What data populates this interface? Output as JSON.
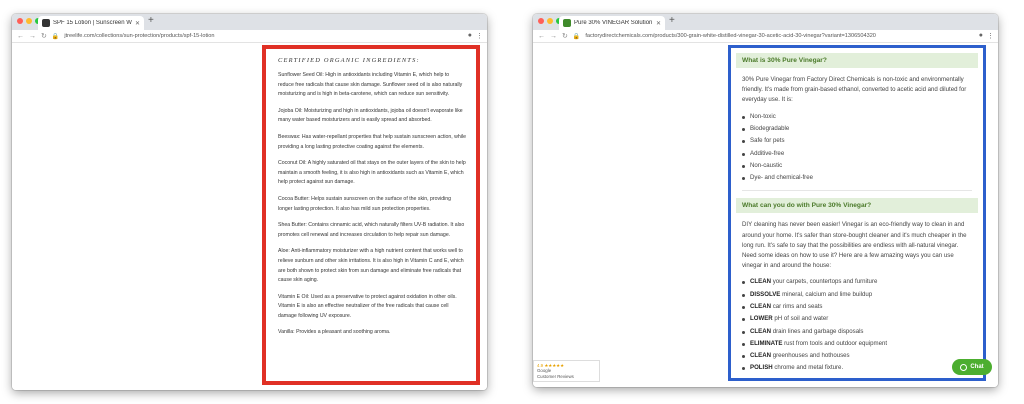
{
  "colors": {
    "red_box": "#e03025",
    "blue_box": "#2d5fcc",
    "header_bg": "#e2efda",
    "header_text": "#4b7a2a",
    "chat_green": "#4cae2f"
  },
  "left_browser": {
    "tab_title": "SPF 15 Lotion | Sunscreen Wit",
    "url": "jtreelife.com/collections/sun-protection/products/spf-15-lotion",
    "heading": "CERTIFIED ORGANIC INGREDIENTS:",
    "paragraphs": [
      "Sunflower Seed Oil: High in antioxidants including Vitamin E, which help to reduce free radicals that cause skin damage. Sunflower seed oil is also naturally moisturizing and is high in beta-carotene, which can reduce sun sensitivity.",
      "Jojoba Oil: Moisturizing and high in antioxidants, jojoba oil doesn't evaporate like many water based moisturizers and is easily spread and absorbed.",
      "Beeswax: Has water-repellant properties that help sustain sunscreen action, while providing a long lasting protective coating against the elements.",
      "Coconut Oil: A highly saturated oil that stays on the outer layers of the skin to help maintain a smooth feeling, it is also high in antioxidants such as Vitamin E, which help protect against sun damage.",
      "Cocoa Butter: Helps sustain sunscreen on the surface of the skin, providing longer lasting protection. It also has mild sun protection properties.",
      "Shea Butter: Contains cinnamic acid, which naturally filters UV-B radiation. It also promotes cell renewal and increases circulation to help repair sun damage.",
      "Aloe: Anti-inflammatory moisturizer with a high nutrient content that works well to relieve sunburn and other skin irritations. It is also high in Vitamin C and E, which are both shown to protect skin from sun damage and eliminate free radicals that cause skin aging.",
      "Vitamin E Oil: Used as a preservative to protect against oxidation in other oils. Vitamin E is also an effective neutralizer of the free radicals that cause cell damage following UV exposure.",
      "Vanilla: Provides a pleasant and soothing aroma."
    ]
  },
  "right_browser": {
    "tab_title": "Pure 30% VINEGAR Solution -",
    "url": "factorydirectchemicals.com/products/300-grain-white-distilled-vinegar-30-acetic-acid-30-vinegar?variant=1306504320",
    "section1": {
      "header": "What is 30% Pure Vinegar?",
      "intro": "30% Pure Vinegar from Factory Direct Chemicals is non-toxic and environmentally friendly. It's made from grain-based ethanol, converted to acetic acid and diluted for everyday use. It is:",
      "bullets": [
        "Non-toxic",
        "Biodegradable",
        "Safe for pets",
        "Additive-free",
        "Non-caustic",
        "Dye- and chemical-free"
      ]
    },
    "section2": {
      "header": "What can you do with Pure 30% Vinegar?",
      "intro": "DIY cleaning has never been easier! Vinegar is an eco-friendly way to clean in and around your home. It's safer than store-bought cleaner and it's much cheaper in the long run. It's safe to say that the possibilities are endless with all-natural vinegar. Need some ideas on how to use it? Here are a few amazing ways you can use vinegar in and around the house:",
      "uses": [
        {
          "verb": "CLEAN",
          "rest": " your carpets, countertops and furniture"
        },
        {
          "verb": "DISSOLVE",
          "rest": " mineral, calcium and lime buildup"
        },
        {
          "verb": "CLEAN",
          "rest": " car rims and seats"
        },
        {
          "verb": "LOWER",
          "rest": " pH of soil and water"
        },
        {
          "verb": "CLEAN",
          "rest": " drain lines and garbage disposals"
        },
        {
          "verb": "ELIMINATE",
          "rest": " rust from tools and outdoor equipment"
        },
        {
          "verb": "CLEAN",
          "rest": " greenhouses and hothouses"
        },
        {
          "verb": "POLISH",
          "rest": " chrome and metal fixture."
        }
      ]
    },
    "google_review": {
      "rating": "4.9 ★★★★★",
      "line2": "Google",
      "line3": "Customer Reviews"
    },
    "chat_label": "Chat"
  }
}
